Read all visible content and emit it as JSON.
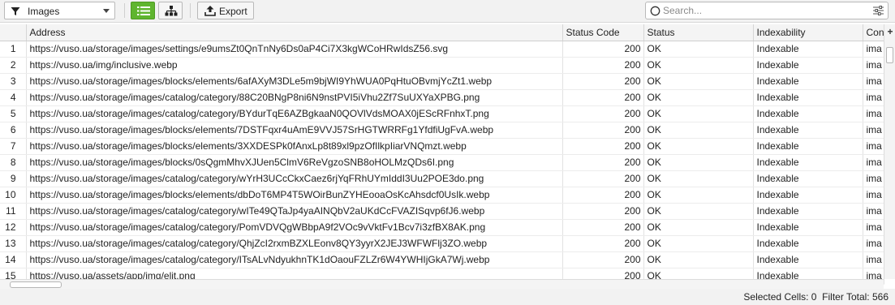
{
  "toolbar": {
    "filter_value": "Images",
    "export_label": "Export",
    "search_placeholder": "Search...",
    "active_color": "#5fb52f"
  },
  "table": {
    "columns": [
      "",
      "Address",
      "Status Code",
      "Status",
      "Indexability",
      "Con"
    ],
    "rows": [
      {
        "n": "1",
        "address": "https://vuso.ua/storage/images/settings/e9umsZt0QnTnNy6Ds0aP4Ci7X3kgWCoHRwIdsZ56.svg",
        "code": "200",
        "status": "OK",
        "indexability": "Indexable",
        "content": "ima"
      },
      {
        "n": "2",
        "address": "https://vuso.ua/img/inclusive.webp",
        "code": "200",
        "status": "OK",
        "indexability": "Indexable",
        "content": "ima"
      },
      {
        "n": "3",
        "address": "https://vuso.ua/storage/images/blocks/elements/6afAXyM3DLe5m9bjWI9YhWUA0PqHtuOBvmjYcZt1.webp",
        "code": "200",
        "status": "OK",
        "indexability": "Indexable",
        "content": "ima"
      },
      {
        "n": "4",
        "address": "https://vuso.ua/storage/images/catalog/category/88C20BNgP8ni6N9nstPVI5iVhu2Zf7SuUXYaXPBG.png",
        "code": "200",
        "status": "OK",
        "indexability": "Indexable",
        "content": "ima"
      },
      {
        "n": "5",
        "address": "https://vuso.ua/storage/images/catalog/category/BYdurTqE6AZBgkaaN0QOVlVdsMOAX0jEScRFnhxT.png",
        "code": "200",
        "status": "OK",
        "indexability": "Indexable",
        "content": "ima"
      },
      {
        "n": "6",
        "address": "https://vuso.ua/storage/images/blocks/elements/7DSTFqxr4uAmE9VVJ57SrHGTWRRFg1YfdfiUgFvA.webp",
        "code": "200",
        "status": "OK",
        "indexability": "Indexable",
        "content": "ima"
      },
      {
        "n": "7",
        "address": "https://vuso.ua/storage/images/blocks/elements/3XXDESPk0fAnxLp8t89xl9pzOfIlkpIiarVNQmzt.webp",
        "code": "200",
        "status": "OK",
        "indexability": "Indexable",
        "content": "ima"
      },
      {
        "n": "8",
        "address": "https://vuso.ua/storage/images/blocks/0sQgmMhvXJUen5ClmV6ReVgzoSNB8oHOLMzQDs6I.png",
        "code": "200",
        "status": "OK",
        "indexability": "Indexable",
        "content": "ima"
      },
      {
        "n": "9",
        "address": "https://vuso.ua/storage/images/catalog/category/wYrH3UCcCkxCaez6rjYqFRhUYmIddI3Uu2POE3do.png",
        "code": "200",
        "status": "OK",
        "indexability": "Indexable",
        "content": "ima"
      },
      {
        "n": "10",
        "address": "https://vuso.ua/storage/images/blocks/elements/dbDoT6MP4T5WOirBunZYHEooaOsKcAhsdcf0UsIk.webp",
        "code": "200",
        "status": "OK",
        "indexability": "Indexable",
        "content": "ima"
      },
      {
        "n": "11",
        "address": "https://vuso.ua/storage/images/catalog/category/wITe49QTaJp4yaAINQbV2aUKdCcFVAZISqvp6fJ6.webp",
        "code": "200",
        "status": "OK",
        "indexability": "Indexable",
        "content": "ima"
      },
      {
        "n": "12",
        "address": "https://vuso.ua/storage/images/catalog/category/PomVDVQgWBbpA9f2VOc9vVktFv1Bcv7i3zfBX8AK.png",
        "code": "200",
        "status": "OK",
        "indexability": "Indexable",
        "content": "ima"
      },
      {
        "n": "13",
        "address": "https://vuso.ua/storage/images/catalog/category/QhjZcI2rxmBZXLEonv8QY3yyrX2JEJ3WFWFlj3ZO.webp",
        "code": "200",
        "status": "OK",
        "indexability": "Indexable",
        "content": "ima"
      },
      {
        "n": "14",
        "address": "https://vuso.ua/storage/images/catalog/category/ITsALvNdyukhnTK1dOaouFZLZr6W4YWHIjGkA7Wj.webp",
        "code": "200",
        "status": "OK",
        "indexability": "Indexable",
        "content": "ima"
      },
      {
        "n": "15",
        "address": "https://vuso.ua/assets/app/img/elit.png",
        "code": "200",
        "status": "OK",
        "indexability": "Indexable",
        "content": "ima"
      }
    ]
  },
  "statusbar": {
    "selected_label": "Selected Cells:",
    "selected_value": "0",
    "filter_label": "Filter Total:",
    "filter_value": "566"
  }
}
